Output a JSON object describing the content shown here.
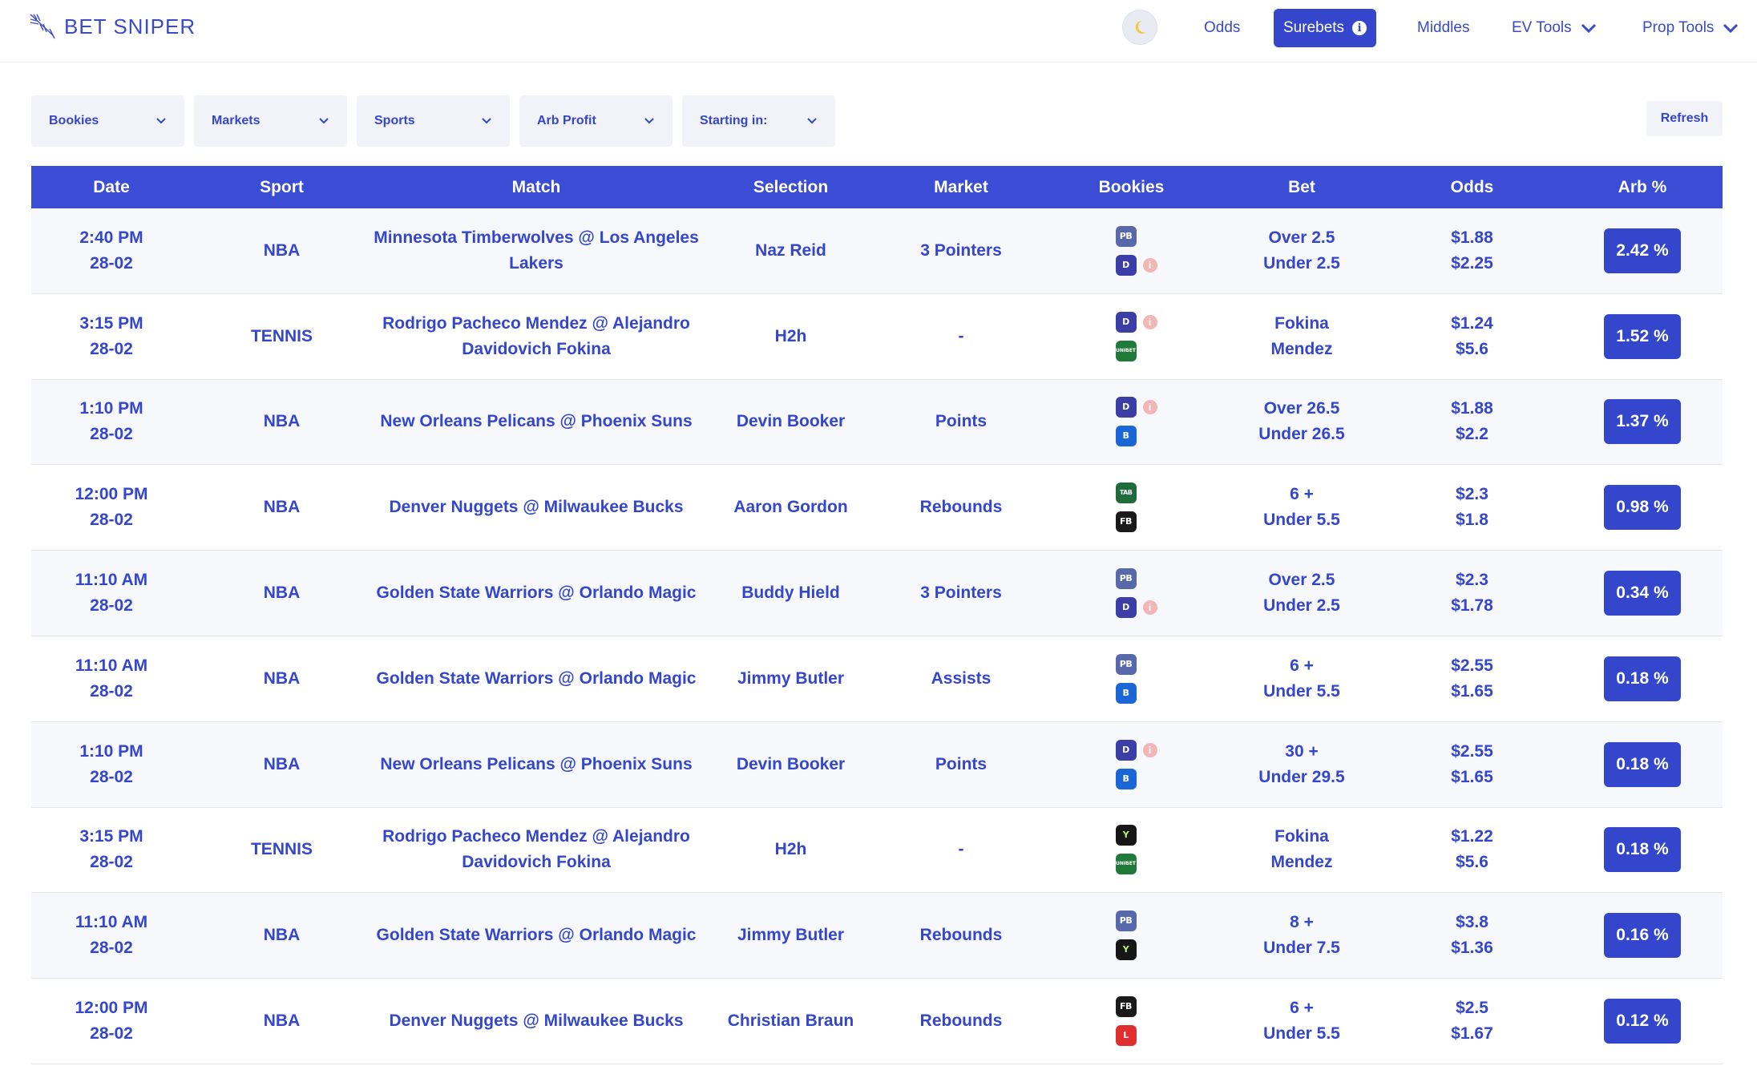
{
  "brand": {
    "name": "BET SNIPER"
  },
  "nav": {
    "odds": "Odds",
    "surebets": "Surebets",
    "middles": "Middles",
    "ev_tools": "EV Tools",
    "prop_tools": "Prop Tools"
  },
  "filters": {
    "bookies": "Bookies",
    "markets": "Markets",
    "sports": "Sports",
    "arb_profit": "Arb Profit",
    "starting_in": "Starting in:",
    "refresh": "Refresh"
  },
  "table": {
    "headers": {
      "date": "Date",
      "sport": "Sport",
      "match": "Match",
      "selection": "Selection",
      "market": "Market",
      "bookies": "Bookies",
      "bet": "Bet",
      "odds": "Odds",
      "arb": "Arb %"
    },
    "rows": [
      {
        "time": "2:40 PM",
        "day": "28-02",
        "sport": "NBA",
        "match": "Minnesota Timberwolves @ Los Angeles Lakers",
        "selection": "Naz Reid",
        "market": "3 Pointers",
        "bet1": "Over 2.5",
        "bet2": "Under 2.5",
        "odds1": "$1.88",
        "odds2": "$2.25",
        "arb": "2.42 %"
      },
      {
        "time": "3:15 PM",
        "day": "28-02",
        "sport": "TENNIS",
        "match": "Rodrigo Pacheco Mendez @ Alejandro Davidovich Fokina",
        "selection": "H2h",
        "market": "-",
        "bet1": "Fokina",
        "bet2": "Mendez",
        "odds1": "$1.24",
        "odds2": "$5.6",
        "arb": "1.52 %"
      },
      {
        "time": "1:10 PM",
        "day": "28-02",
        "sport": "NBA",
        "match": "New Orleans Pelicans @ Phoenix Suns",
        "selection": "Devin Booker",
        "market": "Points",
        "bet1": "Over 26.5",
        "bet2": "Under 26.5",
        "odds1": "$1.88",
        "odds2": "$2.2",
        "arb": "1.37 %"
      },
      {
        "time": "12:00 PM",
        "day": "28-02",
        "sport": "NBA",
        "match": "Denver Nuggets @ Milwaukee Bucks",
        "selection": "Aaron Gordon",
        "market": "Rebounds",
        "bet1": "6 +",
        "bet2": "Under 5.5",
        "odds1": "$2.3",
        "odds2": "$1.8",
        "arb": "0.98 %"
      },
      {
        "time": "11:10 AM",
        "day": "28-02",
        "sport": "NBA",
        "match": "Golden State Warriors @ Orlando Magic",
        "selection": "Buddy Hield",
        "market": "3 Pointers",
        "bet1": "Over 2.5",
        "bet2": "Under 2.5",
        "odds1": "$2.3",
        "odds2": "$1.78",
        "arb": "0.34 %"
      },
      {
        "time": "11:10 AM",
        "day": "28-02",
        "sport": "NBA",
        "match": "Golden State Warriors @ Orlando Magic",
        "selection": "Jimmy Butler",
        "market": "Assists",
        "bet1": "6 +",
        "bet2": "Under 5.5",
        "odds1": "$2.55",
        "odds2": "$1.65",
        "arb": "0.18 %"
      },
      {
        "time": "1:10 PM",
        "day": "28-02",
        "sport": "NBA",
        "match": "New Orleans Pelicans @ Phoenix Suns",
        "selection": "Devin Booker",
        "market": "Points",
        "bet1": "30 +",
        "bet2": "Under 29.5",
        "odds1": "$2.55",
        "odds2": "$1.65",
        "arb": "0.18 %"
      },
      {
        "time": "3:15 PM",
        "day": "28-02",
        "sport": "TENNIS",
        "match": "Rodrigo Pacheco Mendez @ Alejandro Davidovich Fokina",
        "selection": "H2h",
        "market": "-",
        "bet1": "Fokina",
        "bet2": "Mendez",
        "odds1": "$1.22",
        "odds2": "$5.6",
        "arb": "0.18 %"
      },
      {
        "time": "11:10 AM",
        "day": "28-02",
        "sport": "NBA",
        "match": "Golden State Warriors @ Orlando Magic",
        "selection": "Jimmy Butler",
        "market": "Rebounds",
        "bet1": "8 +",
        "bet2": "Under 7.5",
        "odds1": "$3.8",
        "odds2": "$1.36",
        "arb": "0.16 %"
      },
      {
        "time": "12:00 PM",
        "day": "28-02",
        "sport": "NBA",
        "match": "Denver Nuggets @ Milwaukee Bucks",
        "selection": "Christian Braun",
        "market": "Rebounds",
        "bet1": "6 +",
        "bet2": "Under 5.5",
        "odds1": "$2.5",
        "odds2": "$1.67",
        "arb": "0.12 %"
      }
    ]
  },
  "bookie_logos": {
    "row0": [
      "pb-logo-icon",
      "draftkings-logo-icon"
    ],
    "row1": [
      "draftkings-logo-icon",
      "unibet-logo-icon"
    ],
    "row2": [
      "draftkings-logo-icon",
      "betr-logo-icon"
    ],
    "row3": [
      "tab-logo-icon",
      "fb-logo-icon"
    ],
    "row4": [
      "pb-logo-icon",
      "draftkings-logo-icon"
    ],
    "row5": [
      "pb-logo-icon",
      "betr-logo-icon"
    ],
    "row6": [
      "draftkings-logo-icon",
      "betr-logo-icon"
    ],
    "row7": [
      "y-logo-icon",
      "unibet-logo-icon"
    ],
    "row8": [
      "pb-logo-icon",
      "y-logo-icon"
    ],
    "row9": [
      "fb-logo-icon",
      "ladbrokes-logo-icon"
    ]
  },
  "colors": {
    "accent": "#3447cc",
    "header": "#3b4dd4",
    "warning": "#f3b6b6"
  }
}
